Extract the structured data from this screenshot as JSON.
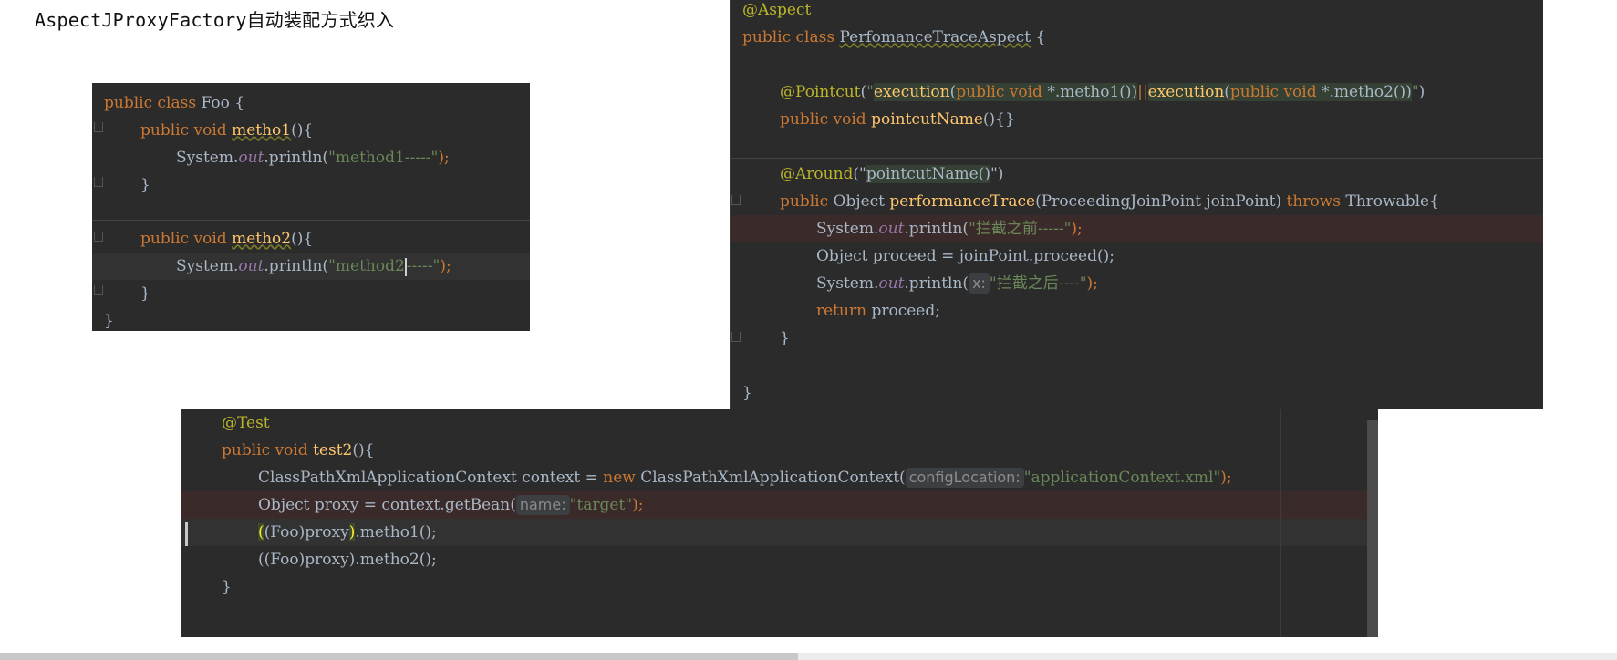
{
  "heading": "AspectJProxyFactory自动装配方式织入",
  "foo_panel": {
    "lines": [
      [
        "public",
        " ",
        "class",
        " Foo {"
      ],
      [
        "public",
        " ",
        "void",
        " ",
        "metho1",
        "(){"
      ],
      [
        "System.",
        "out",
        ".println(",
        "\"method1-----\"",
        ");"
      ],
      [
        "}"
      ],
      [
        "public",
        " ",
        "void",
        " ",
        "metho2",
        "(){"
      ],
      [
        "System.",
        "out",
        ".println(",
        "\"method2",
        "-----\"",
        ");"
      ],
      [
        "}"
      ],
      [
        "}"
      ]
    ]
  },
  "aspect_panel": {
    "annotation": "@Aspect",
    "class_kw1": "public",
    "class_kw2": "class",
    "class_name": "PerfomanceTraceAspect",
    "class_open": " {",
    "pointcut_ann": "@Pointcut",
    "pointcut_open": "(",
    "pointcut_q1": "\"",
    "pc_exec1": "execution",
    "pc_p1": "(",
    "pc_public1": "public",
    "pc_void1": "void",
    "pc_sig1": " *.metho1())",
    "pc_or": "||",
    "pc_exec2": "execution",
    "pc_p2": "(",
    "pc_public2": "public",
    "pc_void2": "void",
    "pc_sig2": " *.metho2())",
    "pointcut_q2": "\"",
    "pointcut_close": ")",
    "pcname_public": "public",
    "pcname_void": "void",
    "pcname_name": "pointcutName",
    "pcname_rest": "(){}",
    "around_ann": "@Around",
    "around_open": "(\"",
    "around_value": "pointcutName()",
    "around_close": "\")",
    "pt_public": "public",
    "pt_type": " Object ",
    "pt_name": "performanceTrace",
    "pt_params": "(ProceedingJoinPoint joinPoint) ",
    "pt_throws": "throws",
    "pt_tail": " Throwable{",
    "s1_a": "System.",
    "s1_out": "out",
    "s1_b": ".println(",
    "s1_str": "\"拦截之前-----\"",
    "s1_c": ");",
    "s2": "Object proceed = joinPoint.proceed();",
    "s3_a": "System.",
    "s3_out": "out",
    "s3_b": ".println(",
    "s3_hint": "x:",
    "s3_str": "\"拦截之后----\"",
    "s3_c": ");",
    "ret_kw": "return",
    "ret_val": " proceed;",
    "close1": "}",
    "close2": "}"
  },
  "test_panel": {
    "ann": "@Test",
    "sig_public": "public",
    "sig_void": "void",
    "sig_name": "test2",
    "sig_rest": "(){",
    "l3_a": "ClassPathXmlApplicationContext context = ",
    "l3_new": "new",
    "l3_b": " ClassPathXmlApplicationContext(",
    "l3_hint": "configLocation:",
    "l3_str": "\"applicationContext.xml\"",
    "l3_c": ");",
    "l4_a": "Object proxy = context.getBean(",
    "l4_hint": "name:",
    "l4_str": "\"target\"",
    "l4_c": ");",
    "l5_open": "(",
    "l5_mid": "(Foo)proxy",
    "l5_close": ")",
    "l5_tail": ".metho1();",
    "l6": "((Foo)proxy).metho2();",
    "close": "}"
  }
}
